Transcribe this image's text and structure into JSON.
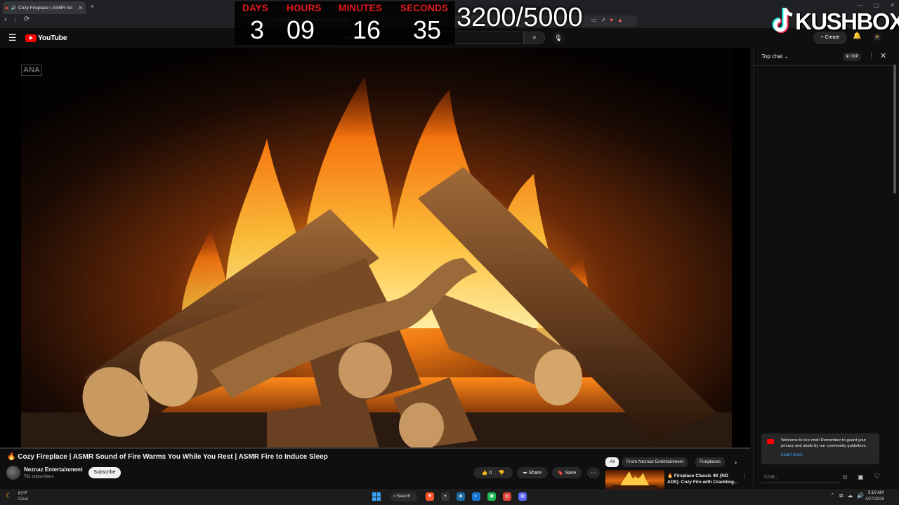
{
  "browser": {
    "tab_title": "Cozy Fireplace | ASMR So",
    "tab_close": "✕",
    "new_tab": "+",
    "window_controls": [
      "—",
      "▢",
      "✕"
    ],
    "url": "youtube.com/watch?v=SDICDRUKk9I",
    "nav_back": "‹",
    "nav_forward": "›",
    "nav_reload": "⟳",
    "extension_icons": [
      "▭",
      "⇗",
      "♥",
      "▲"
    ]
  },
  "youtube": {
    "logo_text": "YouTube",
    "search_placeholder": "Search",
    "search_icon": "⌕",
    "mic_icon": "🎙",
    "create_label": "+ Create",
    "bell_icon": "🔔",
    "menu_icon": "☰"
  },
  "overlay": {
    "labels": [
      "DAYS",
      "HOURS",
      "MINUTES",
      "SECONDS"
    ],
    "values": [
      "3",
      "09",
      "16",
      "35"
    ],
    "goal": "3200/5000",
    "brand_name": "KUSHBOX",
    "watermark": "ANA",
    "label_color": "#e31a1a"
  },
  "video": {
    "title": "🔥 Cozy Fireplace | ASMR Sound of Fire Warms You While You Rest | ASMR Fire to Induce Sleep",
    "channel": "Neznaz Entertainment",
    "subscribers": "761 subscribers",
    "subscribe_label": "Subscribe",
    "likes": "👍 0",
    "dislike_icon": "👎",
    "share_label": "➦ Share",
    "save_label": "🔖 Save",
    "more_label": "⋯"
  },
  "recommendations": {
    "chips": [
      "All",
      "From Neznaz Entertainment",
      "Fireplaces"
    ],
    "chip_next": "›",
    "item_title": "🔥 Fireplace Classic 4K (NO ADS). Cozy Fire with Crackling...",
    "item_more": "⋮"
  },
  "chat": {
    "title": "Top chat ⌄",
    "points": "♛ 0XP",
    "more_icon": "⋮",
    "close_icon": "✕",
    "welcome_text": "Welcome to live chat! Remember to guard your privacy and abide by our community guidelines.",
    "learn_more": "Learn more",
    "input_placeholder": "Chat...",
    "emoji_icon": "☺",
    "gift_icon": "▣",
    "heart_icon": "♡"
  },
  "taskbar": {
    "temperature": "61°F",
    "weather": "Clear",
    "search_label": "⌕ Search",
    "time": "3:10 AM",
    "date": "4/27/2026",
    "tray_icons": [
      "⌃",
      "⧉",
      "☁",
      "🔊"
    ],
    "apps": [
      {
        "name": "brave-icon",
        "glyph": "▼",
        "color": "#fb542b"
      },
      {
        "name": "terminal-icon",
        "glyph": "▪",
        "color": "#333333"
      },
      {
        "name": "steam-icon",
        "glyph": "◈",
        "color": "#1b6aa5"
      },
      {
        "name": "edge-icon",
        "glyph": "◐",
        "color": "#1877d2"
      },
      {
        "name": "spotify-icon",
        "glyph": "◉",
        "color": "#1db954"
      },
      {
        "name": "chrome-icon",
        "glyph": "◎",
        "color": "#db4437"
      },
      {
        "name": "discord-icon",
        "glyph": "◍",
        "color": "#5865f2"
      }
    ]
  }
}
